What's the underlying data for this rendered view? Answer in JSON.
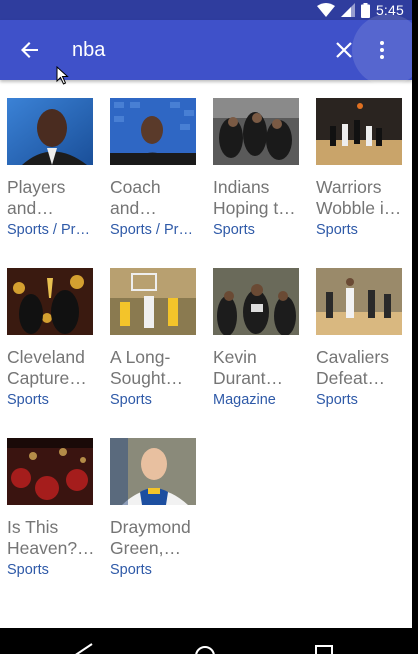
{
  "status_bar": {
    "time": "5:45"
  },
  "toolbar": {
    "search_value": "nba",
    "icons": [
      "back-arrow-icon",
      "close-icon",
      "more-vert-icon"
    ]
  },
  "colors": {
    "status_bar": "#2f3d9e",
    "app_bar": "#3f51c9",
    "title_text": "#757575",
    "category_text": "#2f5aa8"
  },
  "results": [
    {
      "title_line1": "Players",
      "title_line2": "and…",
      "category": "Sports / Pr…"
    },
    {
      "title_line1": "Coach",
      "title_line2": "and…",
      "category": "Sports / Pr…"
    },
    {
      "title_line1": "Indians",
      "title_line2": "Hoping t…",
      "category": "Sports"
    },
    {
      "title_line1": "Warriors",
      "title_line2": "Wobble i…",
      "category": "Sports"
    },
    {
      "title_line1": "Cleveland",
      "title_line2": "Capture…",
      "category": "Sports"
    },
    {
      "title_line1": "A Long-",
      "title_line2": "Sought…",
      "category": "Sports"
    },
    {
      "title_line1": "Kevin",
      "title_line2": "Durant…",
      "category": "Magazine"
    },
    {
      "title_line1": "Cavaliers",
      "title_line2": "Defeat…",
      "category": "Sports"
    },
    {
      "title_line1": "Is This",
      "title_line2": "Heaven?…",
      "category": "Sports"
    },
    {
      "title_line1": "Draymond",
      "title_line2": "Green,…",
      "category": "Sports"
    }
  ]
}
